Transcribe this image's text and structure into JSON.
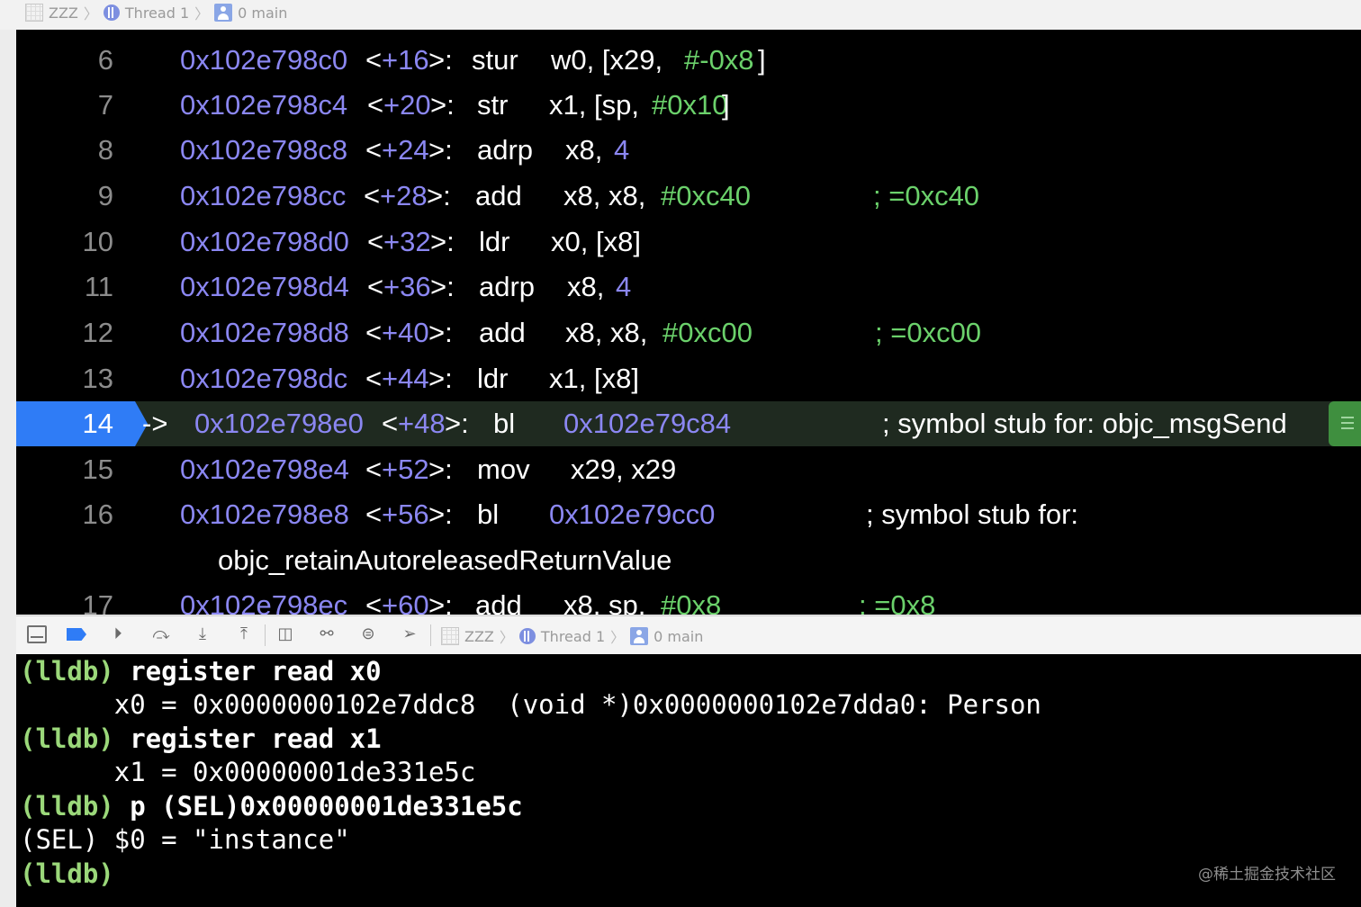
{
  "breadcrumb": {
    "target": "ZZZ",
    "thread": "Thread 1",
    "frame": "0 main"
  },
  "disassembly": [
    {
      "line": "6",
      "addr": "0x102e798c0",
      "offset": "+16",
      "mnemonic": "stur",
      "op_text": "w0, [x29, ",
      "op_num": "#-0x8",
      "op_tail": "]",
      "comment": ""
    },
    {
      "line": "7",
      "addr": "0x102e798c4",
      "offset": "+20",
      "mnemonic": "str",
      "op_text": "x1, [sp, ",
      "op_num": "#0x10",
      "op_tail": "]",
      "comment": ""
    },
    {
      "line": "8",
      "addr": "0x102e798c8",
      "offset": "+24",
      "mnemonic": "adrp",
      "op_text": "x8, ",
      "op_num": "4",
      "op_tail": "",
      "comment": ""
    },
    {
      "line": "9",
      "addr": "0x102e798cc",
      "offset": "+28",
      "mnemonic": "add",
      "op_text": "x8, x8, ",
      "op_num": "#0xc40",
      "op_tail": "",
      "comment": "; =0xc40"
    },
    {
      "line": "10",
      "addr": "0x102e798d0",
      "offset": "+32",
      "mnemonic": "ldr",
      "op_text": "x0, [x8]",
      "op_num": "",
      "op_tail": "",
      "comment": ""
    },
    {
      "line": "11",
      "addr": "0x102e798d4",
      "offset": "+36",
      "mnemonic": "adrp",
      "op_text": "x8, ",
      "op_num": "4",
      "op_tail": "",
      "comment": ""
    },
    {
      "line": "12",
      "addr": "0x102e798d8",
      "offset": "+40",
      "mnemonic": "add",
      "op_text": "x8, x8, ",
      "op_num": "#0xc00",
      "op_tail": "",
      "comment": "; =0xc00"
    },
    {
      "line": "13",
      "addr": "0x102e798dc",
      "offset": "+44",
      "mnemonic": "ldr",
      "op_text": "x1, [x8]",
      "op_num": "",
      "op_tail": "",
      "comment": ""
    }
  ],
  "current": {
    "line": "14",
    "arrow": "->",
    "addr": "0x102e798e0",
    "offset": "+48",
    "mnemonic": "bl",
    "target": "0x102e79c84",
    "comment": "; symbol stub for: objc_msgSend"
  },
  "after": [
    {
      "line": "15",
      "addr": "0x102e798e4",
      "offset": "+52",
      "mnemonic": "mov",
      "op_text": "x29, x29"
    },
    {
      "line": "16",
      "addr": "0x102e798e8",
      "offset": "+56",
      "mnemonic": "bl",
      "target": "0x102e79cc0",
      "comment": "; symbol stub for:",
      "continuation": "objc_retainAutoreleasedReturnValue"
    },
    {
      "line": "17",
      "addr": "0x102e798ec",
      "offset": "+60",
      "mnemonic": "add",
      "op_text": "x8, sp, ",
      "op_num": "#0x8",
      "comment": "; =0x8"
    }
  ],
  "console": {
    "prompt": "(lldb)",
    "cmd1": " register read x0",
    "out1": "      x0 = 0x0000000102e7ddc8  (void *)0x0000000102e7dda0: Person",
    "cmd2": " register read x1",
    "out2": "      x1 = 0x00000001de331e5c",
    "cmd3": " p (SEL)0x00000001de331e5c",
    "out3": "(SEL) $0 = \"instance\""
  },
  "watermark": "@稀土掘金技术社区"
}
